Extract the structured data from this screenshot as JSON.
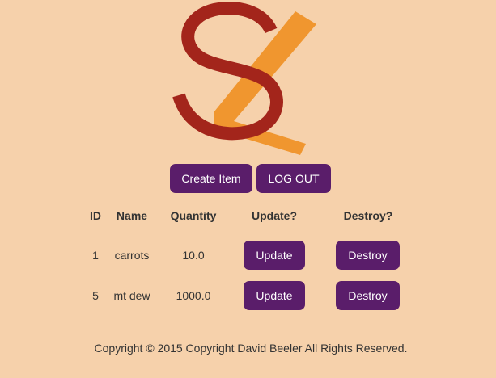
{
  "logo": {
    "name": "SL logo",
    "colors": {
      "s": "#a3251b",
      "slash": "#f0962f"
    }
  },
  "actions": {
    "create_label": "Create Item",
    "logout_label": "LOG OUT"
  },
  "table": {
    "headers": {
      "id": "ID",
      "name": "Name",
      "quantity": "Quantity",
      "update": "Update?",
      "destroy": "Destroy?"
    },
    "rows": [
      {
        "id": "1",
        "name": "carrots",
        "quantity": "10.0",
        "update_label": "Update",
        "destroy_label": "Destroy"
      },
      {
        "id": "5",
        "name": "mt dew",
        "quantity": "1000.0",
        "update_label": "Update",
        "destroy_label": "Destroy"
      }
    ]
  },
  "footer": {
    "text": "Copyright © 2015 Copyright David Beeler All Rights Reserved."
  },
  "colors": {
    "background": "#f6d1ab",
    "button": "#5a1d6a",
    "text": "#333333"
  }
}
